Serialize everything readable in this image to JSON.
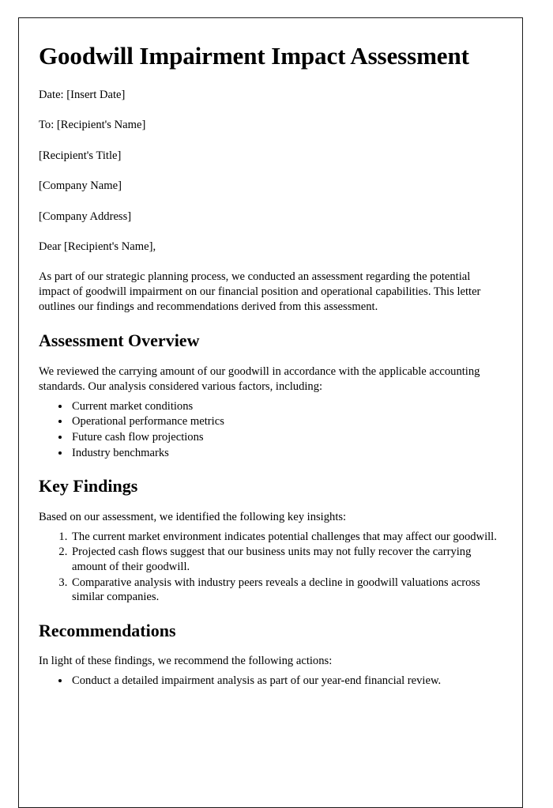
{
  "document": {
    "title": "Goodwill Impairment Impact Assessment",
    "header_lines": [
      "Date: [Insert Date]",
      "To: [Recipient's Name]",
      "[Recipient's Title]",
      "[Company Name]",
      "[Company Address]",
      "Dear [Recipient's Name],"
    ],
    "intro_paragraph": "As part of our strategic planning process, we conducted an assessment regarding the potential impact of goodwill impairment on our financial position and operational capabilities. This letter outlines our findings and recommendations derived from this assessment.",
    "sections": [
      {
        "heading": "Assessment Overview",
        "paragraph": "We reviewed the carrying amount of our goodwill in accordance with the applicable accounting standards. Our analysis considered various factors, including:",
        "list_type": "bullet",
        "items": [
          "Current market conditions",
          "Operational performance metrics",
          "Future cash flow projections",
          "Industry benchmarks"
        ]
      },
      {
        "heading": "Key Findings",
        "paragraph": "Based on our assessment, we identified the following key insights:",
        "list_type": "numbered",
        "items": [
          "The current market environment indicates potential challenges that may affect our goodwill.",
          "Projected cash flows suggest that our business units may not fully recover the carrying amount of their goodwill.",
          "Comparative analysis with industry peers reveals a decline in goodwill valuations across similar companies."
        ]
      },
      {
        "heading": "Recommendations",
        "paragraph": "In light of these findings, we recommend the following actions:",
        "list_type": "bullet",
        "items": [
          "Conduct a detailed impairment analysis as part of our year-end financial review."
        ]
      }
    ]
  }
}
